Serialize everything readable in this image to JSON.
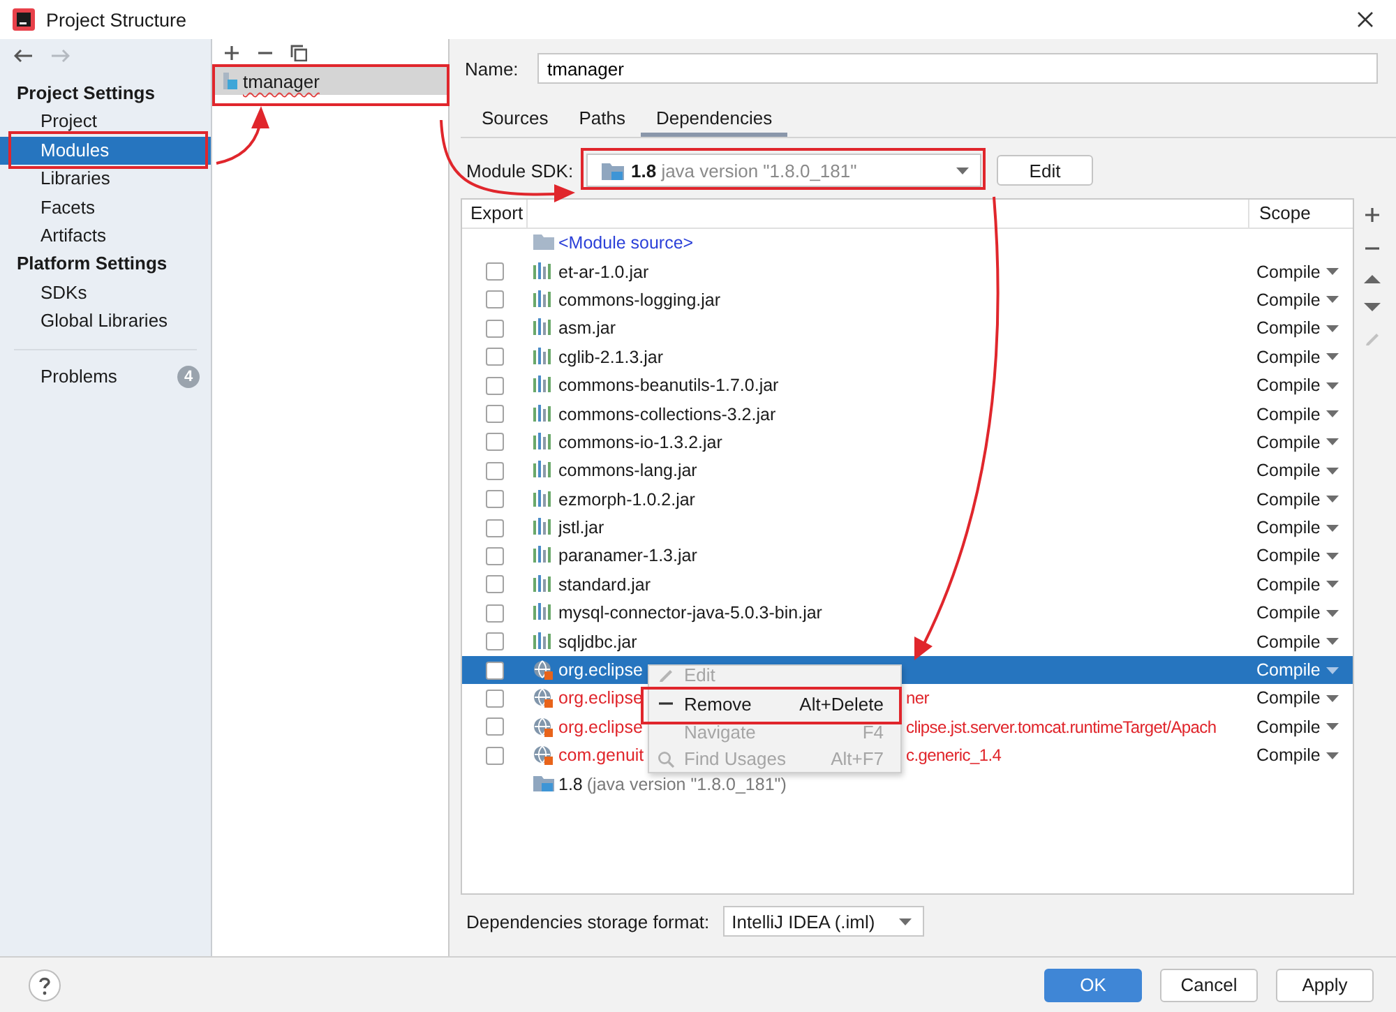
{
  "window": {
    "title": "Project Structure"
  },
  "sidebar": {
    "sections": [
      {
        "title": "Project Settings",
        "items": [
          {
            "label": "Project",
            "selected": false
          },
          {
            "label": "Modules",
            "selected": true
          },
          {
            "label": "Libraries",
            "selected": false
          },
          {
            "label": "Facets",
            "selected": false
          },
          {
            "label": "Artifacts",
            "selected": false
          }
        ]
      },
      {
        "title": "Platform Settings",
        "items": [
          {
            "label": "SDKs",
            "selected": false
          },
          {
            "label": "Global Libraries",
            "selected": false
          }
        ]
      }
    ],
    "problems": {
      "label": "Problems",
      "count": "4"
    }
  },
  "modules": {
    "items": [
      {
        "name": "tmanager",
        "selected": true
      }
    ]
  },
  "module": {
    "name_label": "Name:",
    "name": "tmanager",
    "tabs": [
      {
        "label": "Sources",
        "selected": false
      },
      {
        "label": "Paths",
        "selected": false
      },
      {
        "label": "Dependencies",
        "selected": true
      }
    ],
    "sdk_label": "Module SDK:",
    "sdk_version": "1.8",
    "sdk_detail": "java version \"1.8.0_181\"",
    "edit_button": "Edit"
  },
  "table": {
    "columns": [
      "Export",
      "Scope"
    ],
    "rows": [
      {
        "kind": "source",
        "name": "<Module source>"
      },
      {
        "kind": "jar",
        "name": "et-ar-1.0.jar",
        "checked": false,
        "selected": false,
        "scope": "Compile"
      },
      {
        "kind": "jar",
        "name": "commons-logging.jar",
        "checked": false,
        "selected": false,
        "scope": "Compile"
      },
      {
        "kind": "jar",
        "name": "asm.jar",
        "checked": false,
        "selected": false,
        "scope": "Compile"
      },
      {
        "kind": "jar",
        "name": "cglib-2.1.3.jar",
        "checked": false,
        "selected": false,
        "scope": "Compile"
      },
      {
        "kind": "jar",
        "name": "commons-beanutils-1.7.0.jar",
        "checked": false,
        "selected": false,
        "scope": "Compile"
      },
      {
        "kind": "jar",
        "name": "commons-collections-3.2.jar",
        "checked": false,
        "selected": false,
        "scope": "Compile"
      },
      {
        "kind": "jar",
        "name": "commons-io-1.3.2.jar",
        "checked": false,
        "selected": false,
        "scope": "Compile"
      },
      {
        "kind": "jar",
        "name": "commons-lang.jar",
        "checked": false,
        "selected": false,
        "scope": "Compile"
      },
      {
        "kind": "jar",
        "name": "ezmorph-1.0.2.jar",
        "checked": false,
        "selected": false,
        "scope": "Compile"
      },
      {
        "kind": "jar",
        "name": "jstl.jar",
        "checked": false,
        "selected": false,
        "scope": "Compile"
      },
      {
        "kind": "jar",
        "name": "paranamer-1.3.jar",
        "checked": false,
        "selected": false,
        "scope": "Compile"
      },
      {
        "kind": "jar",
        "name": "standard.jar",
        "checked": false,
        "selected": false,
        "scope": "Compile"
      },
      {
        "kind": "jar",
        "name": "mysql-connector-java-5.0.3-bin.jar",
        "checked": false,
        "selected": false,
        "scope": "Compile"
      },
      {
        "kind": "jar",
        "name": "sqljdbc.jar",
        "checked": false,
        "selected": false,
        "scope": "Compile"
      },
      {
        "kind": "library",
        "name": "org.eclipse",
        "checked": false,
        "selected": true,
        "scope": "Compile"
      },
      {
        "kind": "library",
        "name": "org.eclipse",
        "tail": "ner",
        "checked": false,
        "selected": false,
        "scope": "Compile"
      },
      {
        "kind": "library",
        "name": "org.eclipse",
        "tail": "clipse.jst.server.tomcat.runtimeTarget/Apach",
        "checked": false,
        "selected": false,
        "scope": "Compile"
      },
      {
        "kind": "library",
        "name": "com.genuit",
        "tail": "c.generic_1.4",
        "checked": false,
        "selected": false,
        "scope": "Compile"
      },
      {
        "kind": "sdk",
        "name": "1.8",
        "detail": "(java version \"1.8.0_181\")"
      }
    ]
  },
  "context_menu": {
    "items": [
      {
        "kind": "edit",
        "label": "Edit",
        "disabled": true
      },
      {
        "kind": "remove",
        "label": "Remove",
        "shortcut": "Alt+Delete",
        "disabled": false
      },
      {
        "kind": "navigate",
        "label": "Navigate",
        "shortcut": "F4",
        "disabled": true
      },
      {
        "kind": "find",
        "label": "Find Usages",
        "shortcut": "Alt+F7",
        "disabled": true
      }
    ]
  },
  "storage_format": {
    "label": "Dependencies storage format:",
    "value": "IntelliJ IDEA (.iml)"
  },
  "buttons": [
    {
      "label": "OK",
      "kind": "primary"
    },
    {
      "label": "Cancel",
      "kind": "default"
    },
    {
      "label": "Apply",
      "kind": "default"
    }
  ]
}
